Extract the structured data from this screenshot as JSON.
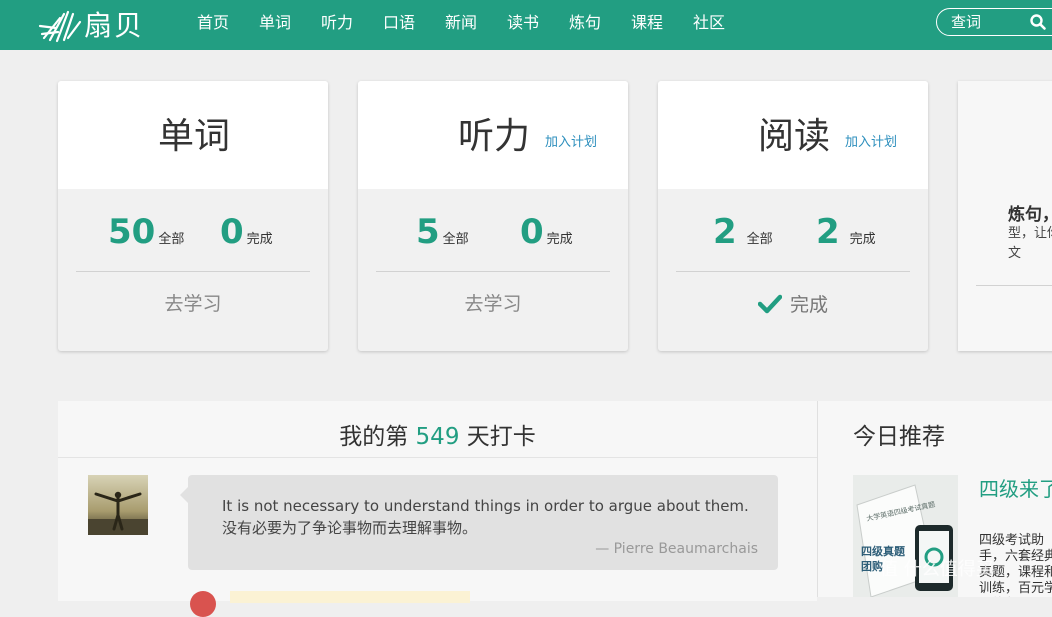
{
  "header": {
    "logo_text": "扇贝",
    "nav": [
      "首页",
      "单词",
      "听力",
      "口语",
      "新闻",
      "读书",
      "炼句",
      "课程",
      "社区"
    ],
    "search_placeholder": "查词",
    "brand_color": "#229e82"
  },
  "cards": [
    {
      "title": "单词",
      "add_plan": "",
      "total": "50",
      "total_label": "全部",
      "done": "0",
      "done_label": "完成",
      "action": "去学习",
      "status": ""
    },
    {
      "title": "听力",
      "add_plan": "加入计划",
      "total": "5",
      "total_label": "全部",
      "done": "0",
      "done_label": "完成",
      "action": "去学习",
      "status": ""
    },
    {
      "title": "阅读",
      "add_plan": "加入计划",
      "total": "2",
      "total_label": "全部",
      "done": "2",
      "done_label": "完成",
      "action": "",
      "status": "完成"
    }
  ],
  "partial_card": {
    "title": "炼句，",
    "desc": "型，让你的英文",
    "desc_line1": "型，让你",
    "desc_line2": "的英文"
  },
  "checkin": {
    "prefix": "我的第",
    "days": "549",
    "suffix": "天打卡",
    "quote_en": "It is not necessary to understand things in order to argue about them.",
    "quote_zh": "没有必要为了争论事物而去理解事物。",
    "quote_author": "— Pierre Beaumarchais"
  },
  "recommend": {
    "title": "今日推荐",
    "item_title": "四级来了",
    "item_desc": "四级考试助手，六套经典真题，课程和训练，百元学习礼包",
    "thumb_text_1": "大学英语四级考试真题",
    "thumb_text_2": "四级真题",
    "thumb_text_3": "团购"
  },
  "watermark": "值 什么值得买"
}
